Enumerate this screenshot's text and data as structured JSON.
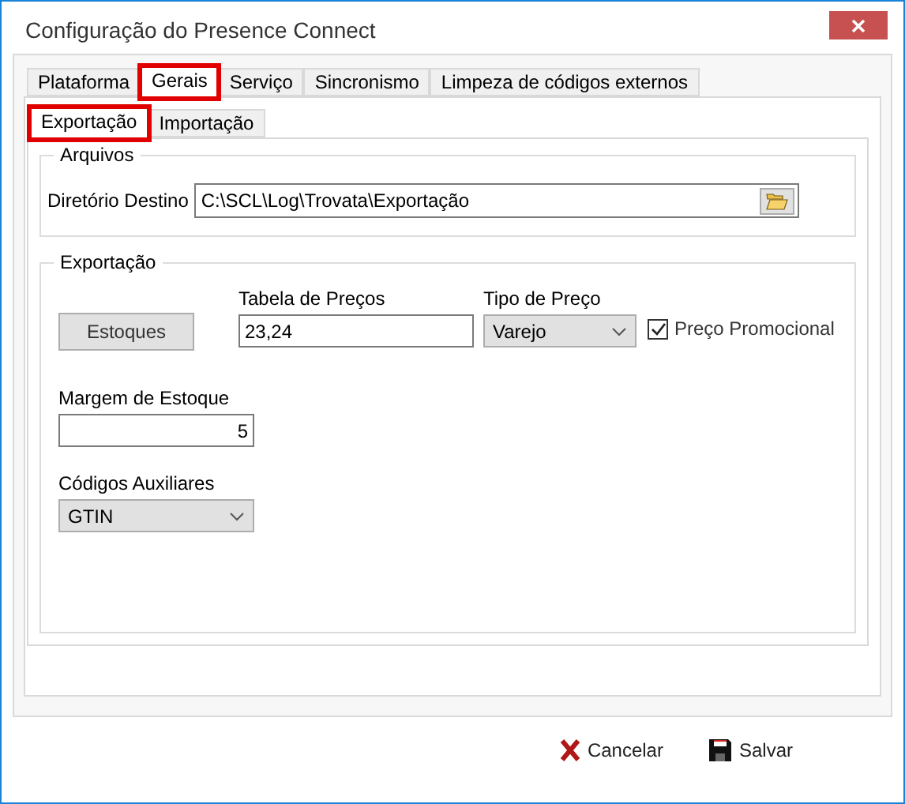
{
  "window": {
    "title": "Configuração do Presence Connect"
  },
  "tabs": [
    {
      "label": "Plataforma",
      "selected": false,
      "highlighted": false
    },
    {
      "label": "Gerais",
      "selected": true,
      "highlighted": true
    },
    {
      "label": "Serviço",
      "selected": false,
      "highlighted": false
    },
    {
      "label": "Sincronismo",
      "selected": false,
      "highlighted": false
    },
    {
      "label": "Limpeza de códigos externos",
      "selected": false,
      "highlighted": false
    }
  ],
  "subtabs": [
    {
      "label": "Exportação",
      "selected": true,
      "highlighted": true
    },
    {
      "label": "Importação",
      "selected": false,
      "highlighted": false
    }
  ],
  "arquivos": {
    "title": "Arquivos",
    "label": "Diretório Destino",
    "value": "C:\\SCL\\Log\\Trovata\\Exportação"
  },
  "exportacao": {
    "title": "Exportação",
    "estoques_button": "Estoques",
    "tabela": {
      "label": "Tabela de Preços",
      "value": "23,24"
    },
    "tipo": {
      "label": "Tipo de Preço",
      "value": "Varejo"
    },
    "promocional": {
      "label": "Preço Promocional",
      "checked": true
    },
    "margem": {
      "label": "Margem de Estoque",
      "value": "5"
    },
    "codigos": {
      "label": "Códigos Auxiliares",
      "value": "GTIN"
    }
  },
  "buttons": [
    {
      "kind": "cancel",
      "label": "Cancelar"
    },
    {
      "kind": "save",
      "label": "Salvar"
    }
  ]
}
